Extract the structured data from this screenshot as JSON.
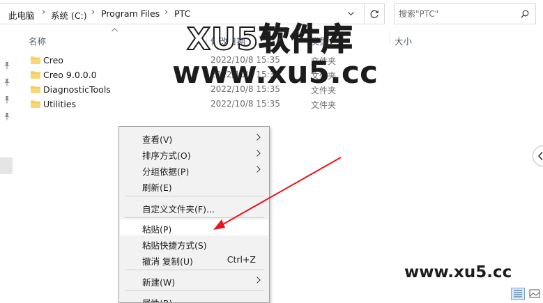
{
  "address": {
    "crumbs": [
      "此电脑",
      "系统 (C:)",
      "Program Files",
      "PTC"
    ],
    "separator": "›"
  },
  "search": {
    "placeholder": "搜索\"PTC\""
  },
  "columns": {
    "name": "名称",
    "date": "修改日期",
    "type": "类型",
    "size": "大小"
  },
  "files": [
    {
      "name": "Creo",
      "date": "2022/10/8 15:35",
      "type": "文件夹"
    },
    {
      "name": "Creo 9.0.0.0",
      "date": "2022/10/8 15:35",
      "type": "文件夹"
    },
    {
      "name": "DiagnosticTools",
      "date": "2022/10/8 15:35",
      "type": "文件夹"
    },
    {
      "name": "Utilities",
      "date": "2022/10/8 15:35",
      "type": "文件夹"
    }
  ],
  "context_menu": {
    "items": [
      {
        "label": "查看(V)",
        "shortcut": ""
      },
      {
        "label": "排序方式(O)",
        "shortcut": ""
      },
      {
        "label": "分组依据(P)",
        "shortcut": ""
      },
      {
        "label": "刷新(E)",
        "shortcut": ""
      },
      {
        "label": "自定义文件夹(F)...",
        "shortcut": ""
      },
      {
        "label": "粘贴(P)",
        "shortcut": ""
      },
      {
        "label": "粘贴快捷方式(S)",
        "shortcut": ""
      },
      {
        "label": "撤消 复制(U)",
        "shortcut": "Ctrl+Z"
      },
      {
        "label": "新建(W)",
        "shortcut": ""
      },
      {
        "label": "属性(R)",
        "shortcut": ""
      }
    ]
  },
  "watermark": {
    "logo_text": "XU5软件库",
    "url_large": "www.xu5.cc",
    "url_small": "www.xu5.cc"
  },
  "colors": {
    "folder": "#f8d775",
    "arrow": "#e8141b",
    "highlight": "#ffffff"
  }
}
